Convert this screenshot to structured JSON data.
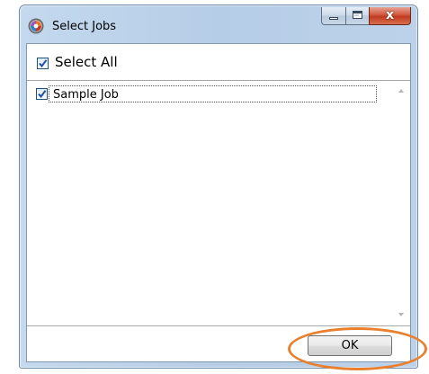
{
  "window": {
    "title": "Select Jobs",
    "app_icon": "app-logo-icon",
    "caption_buttons": {
      "minimize": "minimize-icon",
      "maximize": "maximize-icon",
      "close_glyph": "x"
    }
  },
  "select_all": {
    "label": "Select All",
    "checked": true
  },
  "jobs": [
    {
      "label": "Sample Job",
      "checked": true
    }
  ],
  "buttons": {
    "ok_label": "OK"
  },
  "colors": {
    "highlight": "#e8802f",
    "checkmark": "#1f4fa8",
    "close_button": "#c9452a"
  }
}
